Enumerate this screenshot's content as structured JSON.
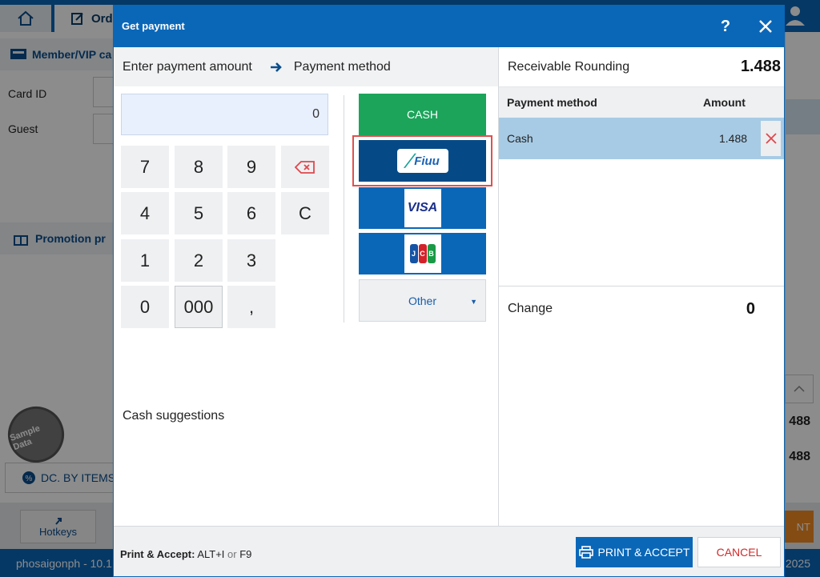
{
  "background": {
    "order_tab_label": "Ord",
    "member_section_label": "Member/VIP ca",
    "card_id_label": "Card ID",
    "guest_label": "Guest",
    "promotion_label": "Promotion pr",
    "sample_stamp_label": "Sample Data",
    "dc_button_label": "DC. BY ITEMS",
    "hotkeys_label": "Hotkeys",
    "status_left": "phosaigonph - 10.1",
    "status_right": "2025",
    "right_value_1": "488",
    "right_value_2": "488",
    "orange_button_label": "NT"
  },
  "modal": {
    "title": "Get payment",
    "help_label": "?",
    "steps": {
      "step1": "Enter payment amount",
      "step2": "Payment method"
    },
    "amount_display": "0",
    "keypad": {
      "k7": "7",
      "k8": "8",
      "k9": "9",
      "k4": "4",
      "k5": "5",
      "k6": "6",
      "kC": "C",
      "k1": "1",
      "k2": "2",
      "k3": "3",
      "k0": "0",
      "k000": "000",
      "kcomma": ","
    },
    "payment_methods": {
      "cash": "CASH",
      "fiuu": "Fiuu",
      "visa": "VISA",
      "jcb": "JCB",
      "other": "Other"
    },
    "cash_suggestions_label": "Cash suggestions",
    "receivable_label": "Receivable Rounding",
    "receivable_value": "1.488",
    "table_header": {
      "method": "Payment method",
      "amount": "Amount"
    },
    "payment_rows": [
      {
        "method": "Cash",
        "amount": "1.488"
      }
    ],
    "change_label": "Change",
    "change_value": "0",
    "footer": {
      "shortcut_label": "Print & Accept:",
      "shortcut_keys_1": "ALT+I",
      "shortcut_or": "or",
      "shortcut_keys_2": "F9",
      "print_accept_label": "PRINT & ACCEPT",
      "cancel_label": "CANCEL"
    }
  },
  "colors": {
    "primary": "#0a67b8",
    "cash_green": "#1ca45a",
    "fiuu_navy": "#054a87",
    "selected_row": "#a7cbe5",
    "cancel_red": "#d12a2a",
    "highlight_red": "#e05050"
  }
}
